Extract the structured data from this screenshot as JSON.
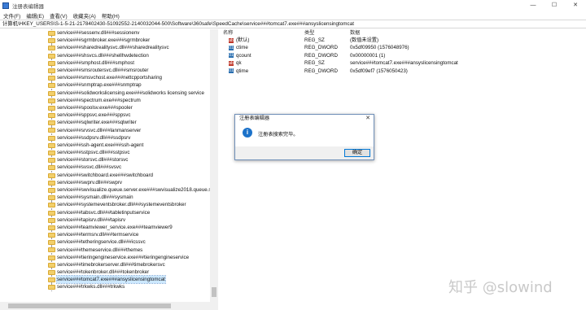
{
  "window": {
    "title": "注册表编辑器",
    "controls": [
      "—",
      "☐",
      "✕"
    ]
  },
  "menu": [
    "文件(F)",
    "编辑(E)",
    "查看(V)",
    "收藏夹(A)",
    "帮助(H)"
  ],
  "address": "计算机\\HKEY_USERS\\S-1-5-21-2178402430-51092552-2140032044-500\\Software\\360safe\\SpeedCache\\service###tomcat7.exe###ansyslicensingtomcat",
  "tree": {
    "items": [
      {
        "label": "service###sessenv.dll###sessionenv"
      },
      {
        "label": "service###sgrmbroker.exe###sgrmbroker"
      },
      {
        "label": "service###sharedrealitysvc.dll###sharedrealitysvc"
      },
      {
        "label": "service###shsvcs.dll###shellhwdetection"
      },
      {
        "label": "service###smphost.dll###smphost"
      },
      {
        "label": "service###smsroutersvc.dll###smsrouter"
      },
      {
        "label": "service###smsvchost.exe###nettcpportsharing"
      },
      {
        "label": "service###snmptrap.exe###snmptrap"
      },
      {
        "label": "service###solidworkslicensing.exe###solidworks licensing service"
      },
      {
        "label": "service###spectrum.exe###spectrum"
      },
      {
        "label": "service###spoolsv.exe###spooler"
      },
      {
        "label": "service###sppsvc.exe###sppsvc"
      },
      {
        "label": "service###sqlwriter.exe###sqlwriter"
      },
      {
        "label": "service###srvsvc.dll###lanmanserver"
      },
      {
        "label": "service###ssdpsrv.dll###ssdpsrv"
      },
      {
        "label": "service###ssh-agent.exe###ssh-agent"
      },
      {
        "label": "service###sstpsvc.dll###sstpsvc"
      },
      {
        "label": "service###storsvc.dll###storsvc"
      },
      {
        "label": "service###svsvc.dll###svsvc"
      },
      {
        "label": "service###switchboard.exe###switchboard"
      },
      {
        "label": "service###swprv.dll###swprv"
      },
      {
        "label": "service###swvisualize.queue.server.exe###swvisualize2018.queue.se"
      },
      {
        "label": "service###sysmain.dll###sysmain"
      },
      {
        "label": "service###systemeventsbroker.dll###systemeventsbroker"
      },
      {
        "label": "service###tabsvc.dll###tabletinputservice"
      },
      {
        "label": "service###tapisrv.dll###tapisrv"
      },
      {
        "label": "service###teamviewer_service.exe###teamviewer9"
      },
      {
        "label": "service###termsrv.dll###termservice"
      },
      {
        "label": "service###tetheringservice.dll###icssvc"
      },
      {
        "label": "service###themeservice.dll###themes"
      },
      {
        "label": "service###tieringengineservice.exe###tieringengineservice"
      },
      {
        "label": "service###timebrokerserver.dll###timebrokersvc"
      },
      {
        "label": "service###tokenbroker.dll###tokenbroker"
      },
      {
        "label": "service###tomcat7.exe###ansyslicensingtomcat",
        "selected": true
      },
      {
        "label": "service###trkwks.dll###trkwks"
      }
    ]
  },
  "detail": {
    "headers": {
      "name": "名称",
      "type": "类型",
      "data": "数据"
    },
    "rows": [
      {
        "icon": "sz",
        "name": "(默认)",
        "type": "REG_SZ",
        "data": "(数值未设置)"
      },
      {
        "icon": "dw",
        "name": "ctime",
        "type": "REG_DWORD",
        "data": "0x5df09950 (1576048976)"
      },
      {
        "icon": "dw",
        "name": "qcount",
        "type": "REG_DWORD",
        "data": "0x00000001 (1)"
      },
      {
        "icon": "sz",
        "name": "qk",
        "type": "REG_SZ",
        "data": "service###tomcat7.exe###ansyslicensingtomcat"
      },
      {
        "icon": "dw",
        "name": "qtime",
        "type": "REG_DWORD",
        "data": "0x5df09ef7 (1576050423)"
      }
    ]
  },
  "dialog": {
    "title": "注册表编辑器",
    "close": "✕",
    "message": "注册表搜索完毕。",
    "ok_label": "确定",
    "icon_glyph": "i"
  },
  "watermark": "知乎 @slowind",
  "colors": {
    "selection": "#cce8ff",
    "info_icon": "#1c72c9",
    "folder": "#f2cf6b"
  }
}
